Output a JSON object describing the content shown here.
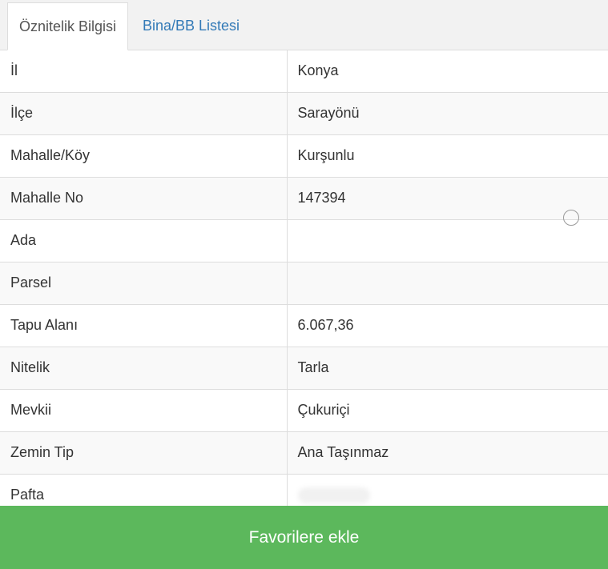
{
  "tabs": [
    {
      "label": "Öznitelik Bilgisi",
      "active": true
    },
    {
      "label": "Bina/BB Listesi",
      "active": false
    }
  ],
  "rows": [
    {
      "key": "İl",
      "value": "Konya"
    },
    {
      "key": "İlçe",
      "value": "Sarayönü"
    },
    {
      "key": "Mahalle/Köy",
      "value": "Kurşunlu"
    },
    {
      "key": "Mahalle No",
      "value": "147394"
    },
    {
      "key": "Ada",
      "value": ""
    },
    {
      "key": "Parsel",
      "value": ""
    },
    {
      "key": "Tapu Alanı",
      "value": "6.067,36"
    },
    {
      "key": "Nitelik",
      "value": "Tarla"
    },
    {
      "key": "Mevkii",
      "value": "Çukuriçi"
    },
    {
      "key": "Zemin Tip",
      "value": "Ana Taşınmaz"
    },
    {
      "key": "Pafta",
      "value": ""
    }
  ],
  "favorite_button": "Favorilere ekle",
  "colors": {
    "accent_green": "#5cb85c",
    "link_blue": "#337ab7"
  }
}
